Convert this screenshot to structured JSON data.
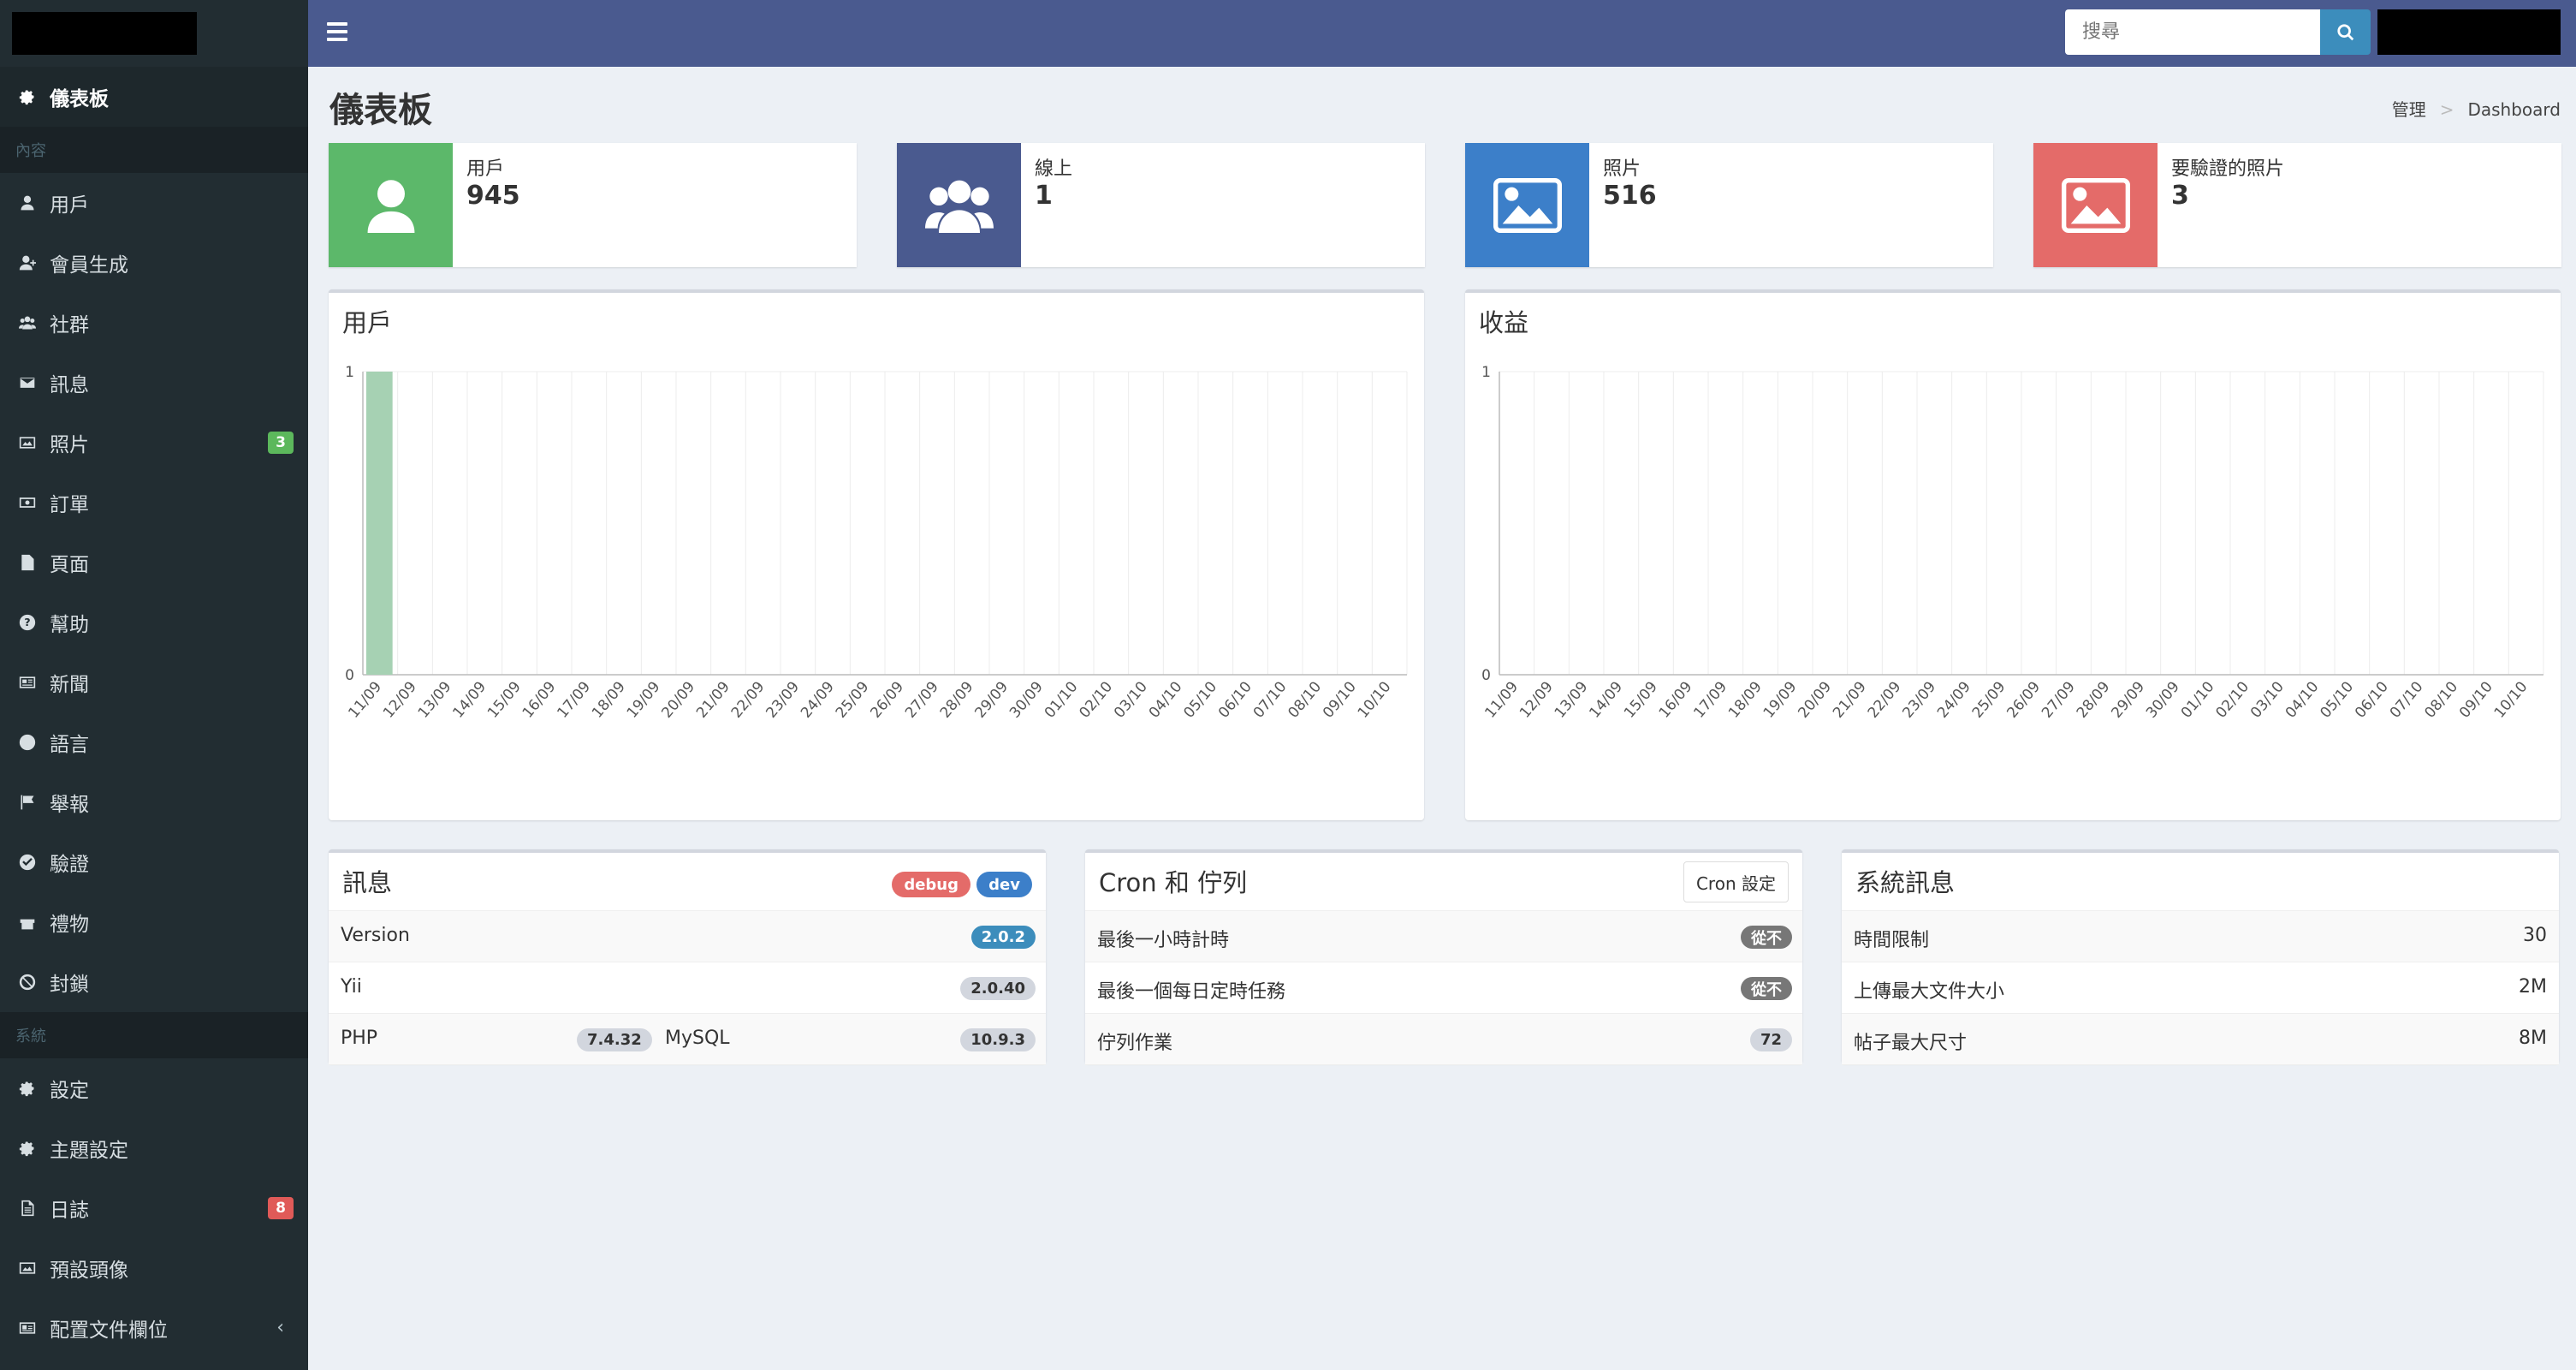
{
  "sidebar": {
    "items_top": [
      {
        "label": "儀表板",
        "icon": "gear-icon",
        "active": true
      }
    ],
    "section_content": "內容",
    "items_content": [
      {
        "label": "用戶",
        "icon": "user-icon"
      },
      {
        "label": "會員生成",
        "icon": "user-plus-icon"
      },
      {
        "label": "社群",
        "icon": "users-icon"
      },
      {
        "label": "訊息",
        "icon": "envelope-icon"
      },
      {
        "label": "照片",
        "icon": "image-icon",
        "badge": "3"
      },
      {
        "label": "訂單",
        "icon": "money-icon"
      },
      {
        "label": "頁面",
        "icon": "file-icon"
      },
      {
        "label": "幫助",
        "icon": "question-icon"
      },
      {
        "label": "新聞",
        "icon": "newspaper-icon"
      },
      {
        "label": "語言",
        "icon": "globe-icon"
      },
      {
        "label": "舉報",
        "icon": "flag-icon"
      },
      {
        "label": "驗證",
        "icon": "check-circle-icon"
      },
      {
        "label": "禮物",
        "icon": "gift-icon"
      },
      {
        "label": "封鎖",
        "icon": "ban-icon"
      }
    ],
    "section_system": "系統",
    "items_system": [
      {
        "label": "設定",
        "icon": "gear-icon"
      },
      {
        "label": "主題設定",
        "icon": "gear-icon"
      },
      {
        "label": "日誌",
        "icon": "file-text-icon",
        "badge": "8"
      },
      {
        "label": "預設頭像",
        "icon": "image-icon"
      },
      {
        "label": "配置文件欄位",
        "icon": "id-card-icon",
        "chevron": "‹"
      }
    ]
  },
  "topbar": {
    "search_placeholder": "搜尋"
  },
  "header": {
    "title": "儀表板",
    "breadcrumb": [
      "管理",
      "Dashboard"
    ],
    "breadcrumb_sep": ">"
  },
  "stats": [
    {
      "label": "用戶",
      "value": "945",
      "color": "#5cb86a",
      "icon": "user-icon"
    },
    {
      "label": "線上",
      "value": "1",
      "color": "#4a5a8f",
      "icon": "users-icon"
    },
    {
      "label": "照片",
      "value": "516",
      "color": "#3c7fc9",
      "icon": "image-icon"
    },
    {
      "label": "要驗證的照片",
      "value": "3",
      "color": "#e46b69",
      "icon": "image-icon"
    }
  ],
  "chart_data": [
    {
      "type": "bar",
      "title": "用戶",
      "categories": [
        "11/09",
        "12/09",
        "13/09",
        "14/09",
        "15/09",
        "16/09",
        "17/09",
        "18/09",
        "19/09",
        "20/09",
        "21/09",
        "22/09",
        "23/09",
        "24/09",
        "25/09",
        "26/09",
        "27/09",
        "28/09",
        "29/09",
        "30/09",
        "01/10",
        "02/10",
        "03/10",
        "04/10",
        "05/10",
        "06/10",
        "07/10",
        "08/10",
        "09/10",
        "10/10"
      ],
      "values": [
        1,
        0,
        0,
        0,
        0,
        0,
        0,
        0,
        0,
        0,
        0,
        0,
        0,
        0,
        0,
        0,
        0,
        0,
        0,
        0,
        0,
        0,
        0,
        0,
        0,
        0,
        0,
        0,
        0,
        0
      ],
      "ylim": [
        0,
        1
      ],
      "yticks": [
        "0",
        "1"
      ],
      "color": "#a6d1b3",
      "grid": true
    },
    {
      "type": "bar",
      "title": "收益",
      "categories": [
        "11/09",
        "12/09",
        "13/09",
        "14/09",
        "15/09",
        "16/09",
        "17/09",
        "18/09",
        "19/09",
        "20/09",
        "21/09",
        "22/09",
        "23/09",
        "24/09",
        "25/09",
        "26/09",
        "27/09",
        "28/09",
        "29/09",
        "30/09",
        "01/10",
        "02/10",
        "03/10",
        "04/10",
        "05/10",
        "06/10",
        "07/10",
        "08/10",
        "09/10",
        "10/10"
      ],
      "values": [
        0,
        0,
        0,
        0,
        0,
        0,
        0,
        0,
        0,
        0,
        0,
        0,
        0,
        0,
        0,
        0,
        0,
        0,
        0,
        0,
        0,
        0,
        0,
        0,
        0,
        0,
        0,
        0,
        0,
        0
      ],
      "ylim": [
        0,
        1
      ],
      "yticks": [
        "0",
        "1"
      ],
      "color": "#a6d1b3",
      "grid": true
    }
  ],
  "info": {
    "title": "訊息",
    "badges": [
      {
        "label": "debug",
        "color": "#e46b69"
      },
      {
        "label": "dev",
        "color": "#3c7fc9"
      }
    ],
    "version_label": "Version",
    "version_value": "2.0.2",
    "yii_label": "Yii",
    "yii_value": "2.0.40",
    "php_label": "PHP",
    "php_value": "7.4.32",
    "mysql_label": "MySQL",
    "mysql_value": "10.9.3"
  },
  "cron": {
    "title": "Cron 和 佇列",
    "button": "Cron 設定",
    "rows": [
      {
        "label": "最後一小時計時",
        "value": "從不"
      },
      {
        "label": "最後一個每日定時任務",
        "value": "從不"
      },
      {
        "label": "佇列作業",
        "value": "72"
      }
    ]
  },
  "system": {
    "title": "系統訊息",
    "rows": [
      {
        "label": "時間限制",
        "value": "30"
      },
      {
        "label": "上傳最大文件大小",
        "value": "2M"
      },
      {
        "label": "帖子最大尺寸",
        "value": "8M"
      }
    ]
  }
}
